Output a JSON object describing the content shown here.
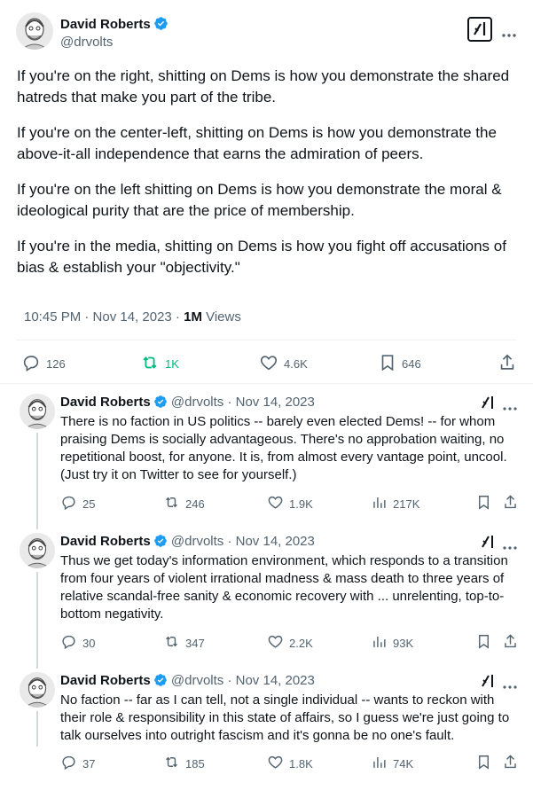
{
  "main": {
    "author": {
      "name": "David Roberts",
      "handle": "@drvolts"
    },
    "paragraphs": [
      "If you're on the right, shitting on Dems is how you demonstrate the shared hatreds that make you part of the tribe.",
      "If you're on the center-left, shitting on Dems is how you demonstrate the above-it-all independence that earns the admiration of peers.",
      "If you're on the left shitting on Dems is how you demonstrate the moral & ideological purity that are the price of membership.",
      "If you're in the media, shitting on Dems is how you fight off accusations of bias & establish your \"objectivity.\""
    ],
    "timestamp": "10:45 PM · Nov 14, 2023 · ",
    "views_count": "1M",
    "views_label": " Views",
    "stats": {
      "replies": "126",
      "reposts": "1K",
      "likes": "4.6K",
      "bookmarks": "646"
    }
  },
  "replies": [
    {
      "name": "David Roberts",
      "handle": "@drvolts",
      "date": "· Nov 14, 2023",
      "text": "There is no faction in US politics -- barely even elected Dems! -- for whom praising Dems is socially advantageous. There's no approbation waiting, no repetitional boost, for anyone. It is, from almost every vantage point, uncool.  (Just try it on Twitter to see for yourself.)",
      "replies": "25",
      "reposts": "246",
      "likes": "1.9K",
      "views": "217K"
    },
    {
      "name": "David Roberts",
      "handle": "@drvolts",
      "date": "· Nov 14, 2023",
      "text": "Thus we get today's information environment, which responds to a transition from four years of violent irrational madness & mass death to three years of relative scandal-free sanity & economic recovery with ... unrelenting, top-to-bottom negativity.",
      "replies": "30",
      "reposts": "347",
      "likes": "2.2K",
      "views": "93K"
    },
    {
      "name": "David Roberts",
      "handle": "@drvolts",
      "date": "· Nov 14, 2023",
      "text": "No faction -- far as I can tell, not a single individual -- wants to reckon with their role & responsibility in this state of affairs, so I guess we're just going to talk ourselves into outright fascism and it's gonna be no one's fault.",
      "replies": "37",
      "reposts": "185",
      "likes": "1.8K",
      "views": "74K"
    }
  ],
  "colors": {
    "verified": "#1d9bf0",
    "repost_active": "#00ba7c",
    "muted": "#536471"
  },
  "icons": [
    "verified-badge-icon",
    "grok-icon",
    "more-icon",
    "reply-icon",
    "repost-icon",
    "like-icon",
    "bookmark-icon",
    "share-icon",
    "views-icon"
  ]
}
